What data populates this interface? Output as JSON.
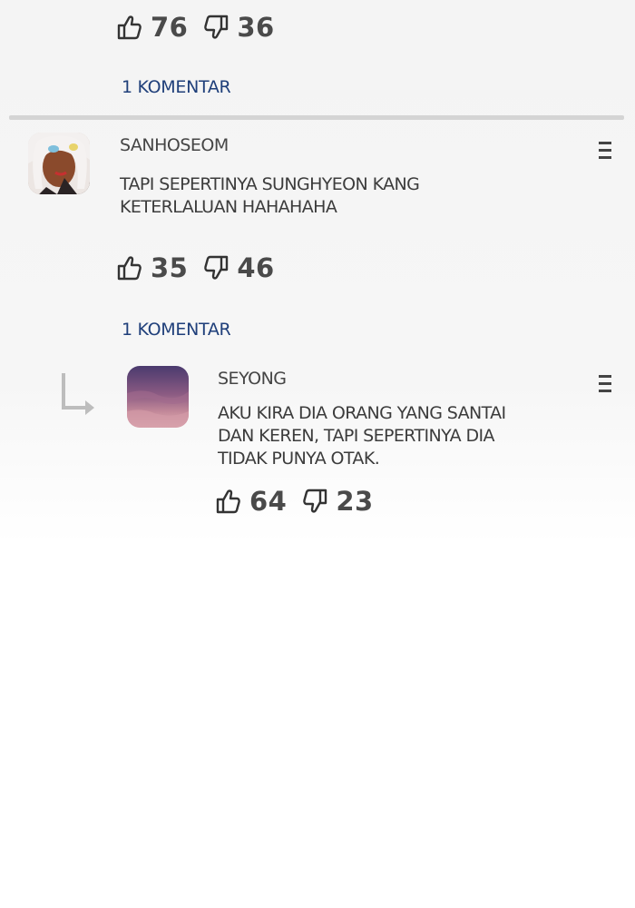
{
  "top_comment": {
    "likes": "76",
    "dislikes": "36",
    "reply_link": "1 KOMENTAR"
  },
  "comment": {
    "username": "SANHOSEOM",
    "text_line1": "TAPI SEPERTINYA SUNGHYEON KANG",
    "text_line2": "KETERLALUAN HAHAHAHA",
    "likes": "35",
    "dislikes": "46",
    "reply_link": "1 KOMENTAR"
  },
  "reply": {
    "username": "SEYONG",
    "text_line1": "AKU KIRA DIA ORANG YANG SANTAI",
    "text_line2": "DAN KEREN, TAPI SEPERTINYA DIA",
    "text_line3": "TIDAK PUNYA OTAK.",
    "likes": "64",
    "dislikes": "23"
  },
  "icons": {
    "like": "thumbs-up-icon",
    "dislike": "thumbs-down-icon",
    "menu": "more-options-icon",
    "reply_indicator": "reply-arrow-icon"
  },
  "colors": {
    "link": "#1f3f7a",
    "text": "#3c3c3c",
    "divider": "#d4d4d4"
  }
}
